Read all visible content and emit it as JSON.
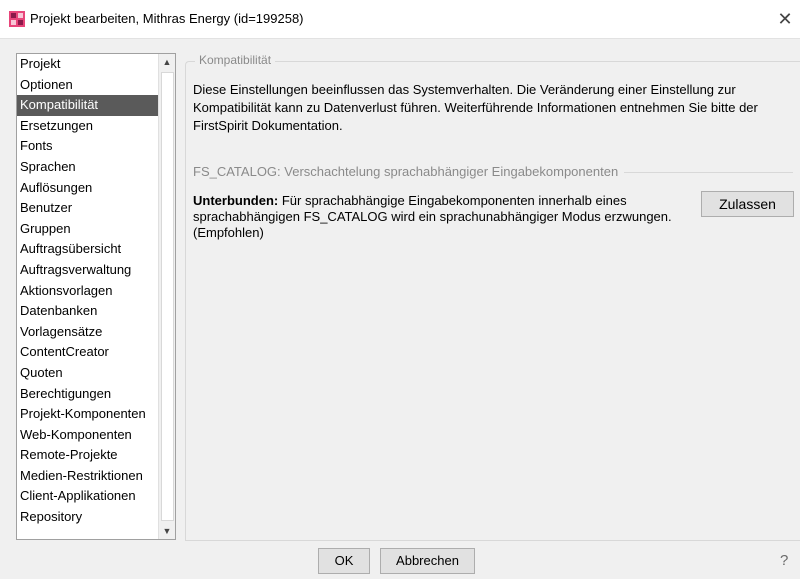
{
  "window": {
    "title": "Projekt bearbeiten, Mithras Energy (id=199258)",
    "close_glyph": "✕"
  },
  "sidebar": {
    "items": [
      {
        "label": "Projekt"
      },
      {
        "label": "Optionen"
      },
      {
        "label": "Kompatibilität",
        "selected": true
      },
      {
        "label": "Ersetzungen"
      },
      {
        "label": "Fonts"
      },
      {
        "label": "Sprachen"
      },
      {
        "label": "Auflösungen"
      },
      {
        "label": "Benutzer"
      },
      {
        "label": "Gruppen"
      },
      {
        "label": "Auftragsübersicht"
      },
      {
        "label": "Auftragsverwaltung"
      },
      {
        "label": "Aktionsvorlagen"
      },
      {
        "label": "Datenbanken"
      },
      {
        "label": "Vorlagensätze"
      },
      {
        "label": "ContentCreator"
      },
      {
        "label": "Quoten"
      },
      {
        "label": "Berechtigungen"
      },
      {
        "label": "Projekt-Komponenten"
      },
      {
        "label": "Web-Komponenten"
      },
      {
        "label": "Remote-Projekte"
      },
      {
        "label": "Medien-Restriktionen"
      },
      {
        "label": "Client-Applikationen"
      },
      {
        "label": "Repository"
      }
    ],
    "scroll_up_glyph": "▲",
    "scroll_down_glyph": "▼"
  },
  "main": {
    "group_title": "Kompatibilität",
    "description": "Diese Einstellungen beeinflussen das Systemverhalten. Die Veränderung einer Einstellung zur Kompatibilität kann zu Datenverlust führen. Weiterführende Informationen entnehmen Sie bitte der FirstSpirit Dokumentation.",
    "setting": {
      "title": "FS_CATALOG: Verschachtelung sprachabhängiger Eingabekomponenten",
      "status_label": "Unterbunden:",
      "status_text": " Für sprachabhängige Eingabekomponenten innerhalb eines sprachabhängigen FS_CATALOG wird ein sprachunabhängiger Modus erzwungen. (Empfohlen)",
      "button_label": "Zulassen"
    }
  },
  "footer": {
    "ok_label": "OK",
    "cancel_label": "Abbrechen",
    "help_label": "?"
  },
  "colors": {
    "selection": "#5a5a5a",
    "app_icon": "#c2185b"
  }
}
